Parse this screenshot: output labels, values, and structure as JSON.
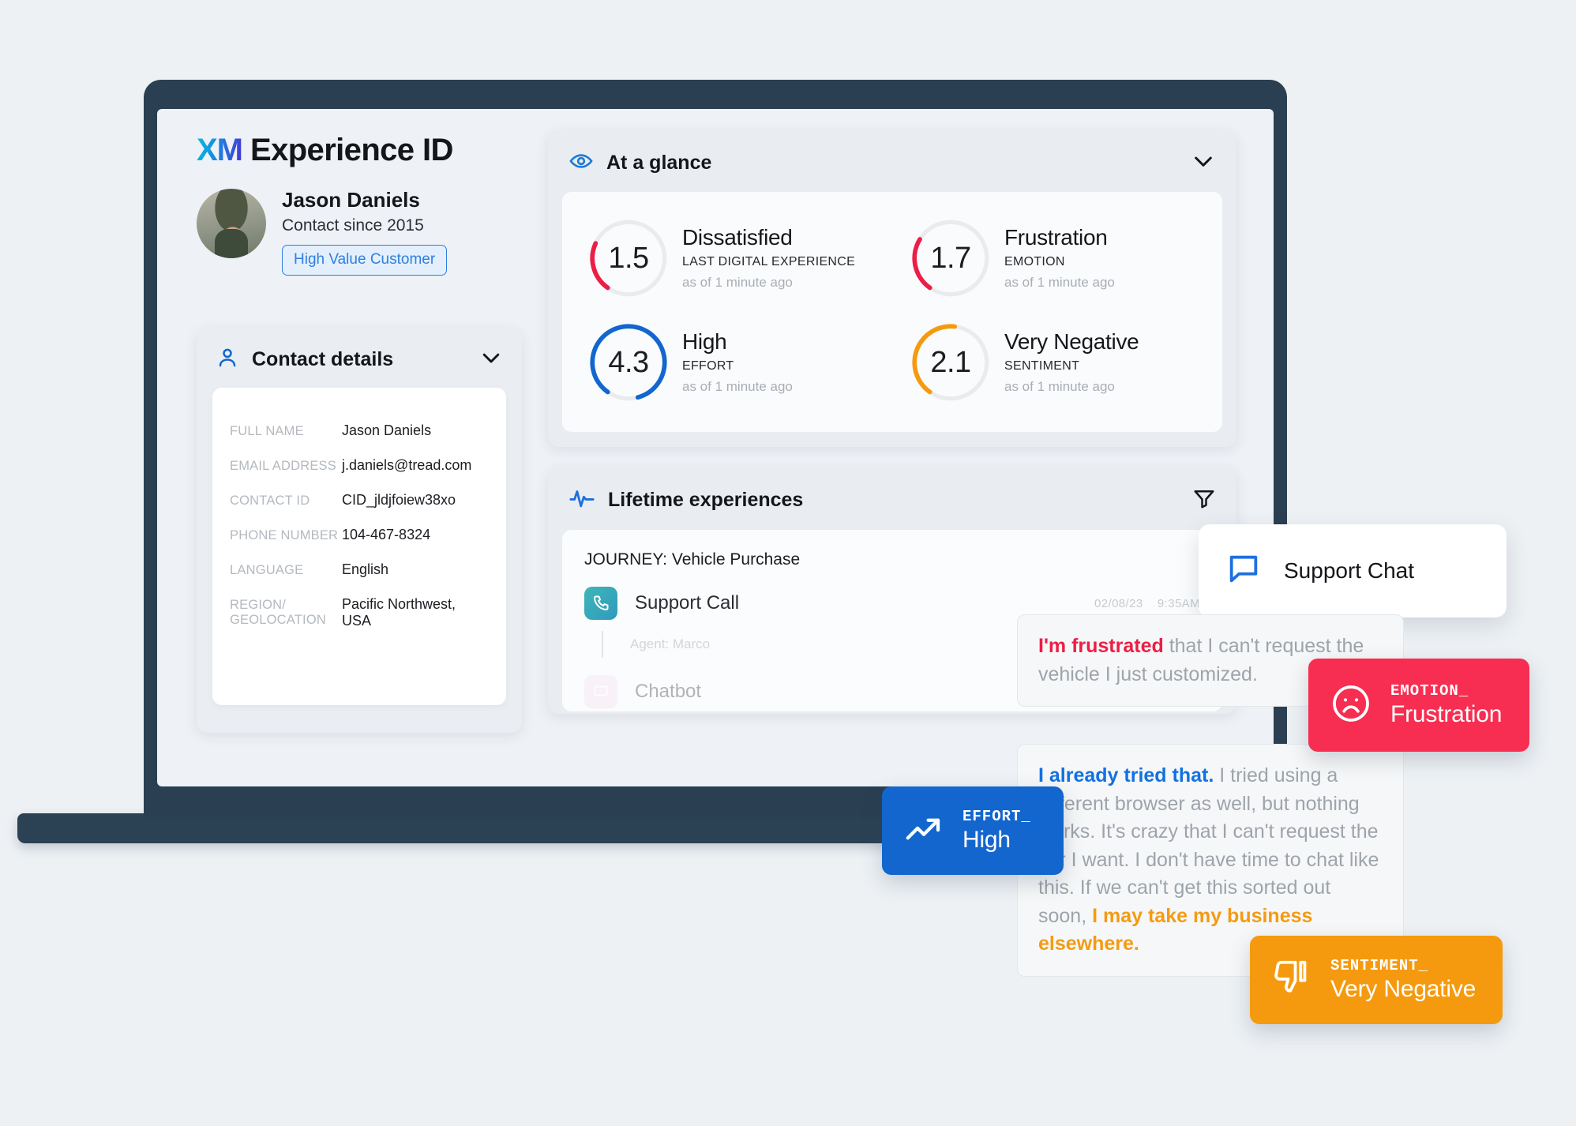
{
  "theme": {
    "background": "#edf1f4",
    "laptop_frame": "#2a3f51",
    "accent_blue": "#1266cd",
    "red": "#f72d51",
    "orange": "#f59a0f",
    "crimson": "#ec1e46"
  },
  "brand": {
    "logo": "XM",
    "title": "Experience ID"
  },
  "profile": {
    "avatar_icon": "user-photo",
    "name": "Jason Daniels",
    "since": "Contact since 2015",
    "badge": "High Value Customer"
  },
  "contact_details": {
    "icon": "person-icon",
    "title": "Contact details",
    "chevron_icon": "chevron-down-icon",
    "rows": [
      {
        "label": "FULL NAME",
        "value": "Jason Daniels"
      },
      {
        "label": "EMAIL ADDRESS",
        "value": "j.daniels@tread.com"
      },
      {
        "label": "CONTACT ID",
        "value": "CID_jldjfoiew38xo"
      },
      {
        "label": "PHONE NUMBER",
        "value": "104-467-8324"
      },
      {
        "label": "LANGUAGE",
        "value": "English"
      },
      {
        "label": "REGION/ GEOLOCATION",
        "value": "Pacific Northwest, USA"
      }
    ]
  },
  "at_a_glance": {
    "icon": "eye-icon",
    "title": "At a glance",
    "chevron_icon": "chevron-down-icon",
    "metrics": [
      {
        "value": "1.5",
        "name": "Dissatisfied",
        "sub": "LAST DIGITAL EXPERIENCE",
        "time": "as of 1 minute ago",
        "color": "#ec1e46",
        "pct": 22
      },
      {
        "value": "1.7",
        "name": "Frustration",
        "sub": "EMOTION",
        "time": "as of 1 minute ago",
        "color": "#ec1e46",
        "pct": 24
      },
      {
        "value": "4.3",
        "name": "High",
        "sub": "EFFORT",
        "time": "as of 1 minute ago",
        "color": "#1266cd",
        "pct": 86
      },
      {
        "value": "2.1",
        "name": "Very Negative",
        "sub": "SENTIMENT",
        "time": "as of 1 minute ago",
        "color": "#f59a0f",
        "pct": 42
      }
    ]
  },
  "lifetime_experiences": {
    "icon": "pulse-icon",
    "title": "Lifetime experiences",
    "filter_icon": "filter-icon",
    "journey_label": "JOURNEY: Vehicle Purchase",
    "rows": [
      {
        "icon": "phone-icon",
        "name": "Support Call",
        "date": "02/08/23",
        "time": "9:35AM",
        "sub": "Agent: Marco"
      },
      {
        "icon": "chat-icon",
        "name": "Chatbot",
        "date": "",
        "time": "",
        "sub": ""
      }
    ]
  },
  "support_chat": {
    "icon": "chat-bubble-icon",
    "label": "Support Chat"
  },
  "messages": [
    {
      "highlight": "I'm frustrated",
      "highlight_color": "red",
      "rest": " that I can't request the vehicle I just customized."
    },
    {
      "highlight": "I already tried that.",
      "highlight_color": "blue",
      "rest": " I tried using a different browser as well, but nothing works. It's crazy that I can't request the car I want. I don't have time to chat like this. If we can't get this sorted out soon, ",
      "tail_highlight": "I may take my business elsewhere."
    }
  ],
  "chips": [
    {
      "key": "EMOTION_",
      "value": "Frustration",
      "icon": "frown-face-icon"
    },
    {
      "key": "EFFORT_",
      "value": "High",
      "icon": "trending-up-icon"
    },
    {
      "key": "SENTIMENT_",
      "value": "Very Negative",
      "icon": "thumbs-down-icon"
    }
  ]
}
